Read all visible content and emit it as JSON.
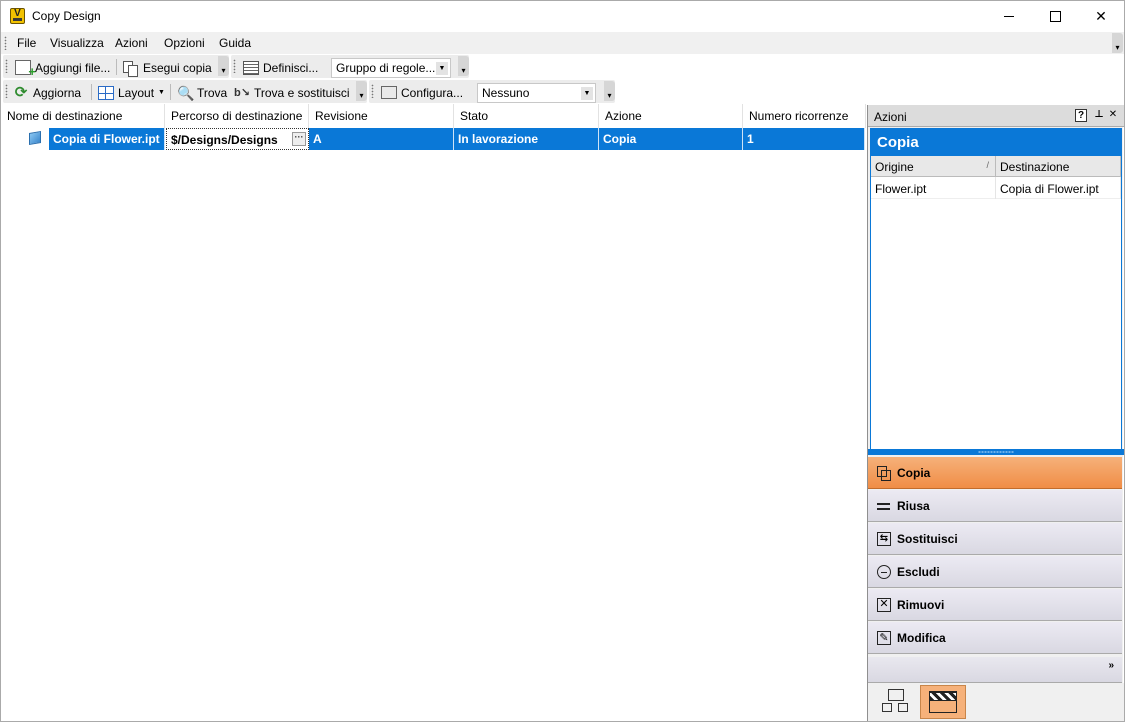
{
  "window": {
    "title": "Copy Design",
    "app_icon_letter": "V"
  },
  "menubar": {
    "items": [
      "File",
      "Visualizza",
      "Azioni",
      "Opzioni",
      "Guida"
    ]
  },
  "toolbar1": {
    "add_files": "Aggiungi file...",
    "run_copy": "Esegui copia",
    "define": "Definisci...",
    "rule_group": "Gruppo di regole..."
  },
  "toolbar2": {
    "refresh": "Aggiorna",
    "layout": "Layout",
    "find": "Trova",
    "find_replace": "Trova e sostituisci",
    "configure": "Configura...",
    "filter_value": "Nessuno"
  },
  "grid": {
    "columns": [
      "Nome di destinazione",
      "Percorso di destinazione",
      "Revisione",
      "Stato",
      "Azione",
      "Numero ricorrenze"
    ],
    "rows": [
      {
        "name": "Copia di Flower.ipt",
        "path": "$/Designs/Designs",
        "revision": "A",
        "state": "In lavorazione",
        "action": "Copia",
        "count": "1"
      }
    ]
  },
  "panel": {
    "title": "Azioni",
    "current_action": "Copia",
    "columns": [
      "Origine",
      "Destinazione"
    ],
    "rows": [
      {
        "origin": "Flower.ipt",
        "destination": "Copia di Flower.ipt"
      }
    ],
    "actions": [
      "Copia",
      "Riusa",
      "Sostituisci",
      "Escludi",
      "Rimuovi",
      "Modifica"
    ],
    "active_action": "Copia"
  },
  "colors": {
    "selection": "#0a78d7",
    "active_action": "#f08d46"
  }
}
